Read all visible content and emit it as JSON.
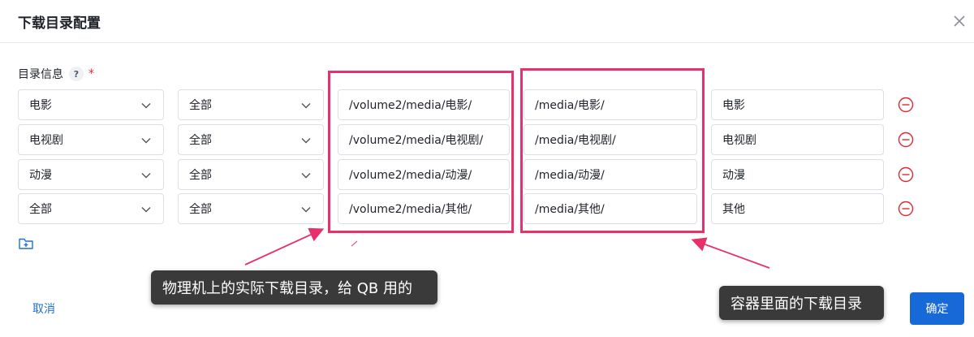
{
  "dialog": {
    "title": "下载目录配置",
    "section_label": "目录信息",
    "help_glyph": "?",
    "required_mark": "*"
  },
  "rows": [
    {
      "type": "电影",
      "scope": "全部",
      "download_path": "/volume2/media/电影/",
      "container_path": "/media/电影/",
      "label": "电影"
    },
    {
      "type": "电视剧",
      "scope": "全部",
      "download_path": "/volume2/media/电视剧/",
      "container_path": "/media/电视剧/",
      "label": "电视剧"
    },
    {
      "type": "动漫",
      "scope": "全部",
      "download_path": "/volume2/media/动漫/",
      "container_path": "/media/动漫/",
      "label": "动漫"
    },
    {
      "type": "全部",
      "scope": "全部",
      "download_path": "/volume2/media/其他/",
      "container_path": "/media/其他/",
      "label": "其他"
    }
  ],
  "annotations": {
    "left_callout": "物理机上的实际下载目录，给 QB 用的",
    "right_callout": "容器里面的下载目录",
    "highlight_color": "#e8306b"
  },
  "footer": {
    "cancel_label": "取消",
    "confirm_label": "确定"
  },
  "icons": {
    "close": "close-icon",
    "dropdown": "chevron-down-icon",
    "remove": "minus-circle-icon",
    "add_folder": "folder-add-icon",
    "help": "help-icon"
  },
  "colors": {
    "primary": "#1769d8",
    "danger": "#e0292f",
    "highlight": "#e8306b"
  }
}
